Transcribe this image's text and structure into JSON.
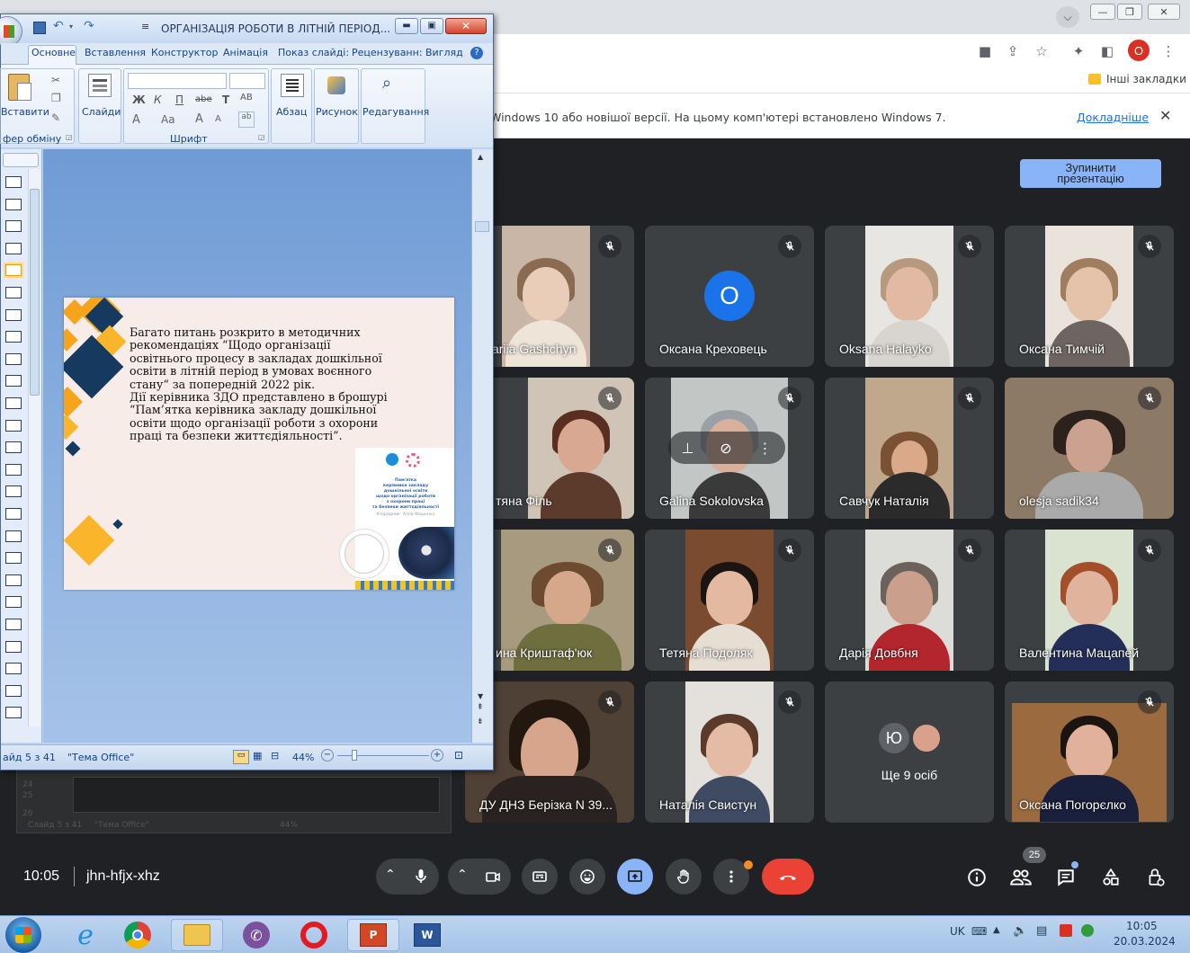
{
  "chrome": {
    "bookmarks_other": "Інші закладки",
    "profile_initial": "O",
    "infobar_text": "Windows 10 або новішої версії. На цьому комп'ютері встановлено Windows 7.",
    "infobar_link": "Докладніше"
  },
  "meet": {
    "stop_presenting": "Зупинити презентацію",
    "time": "10:05",
    "meeting_code": "jhn-hfjx-xhz",
    "participants_count": "25",
    "more_people": "Ще 9 осіб",
    "more_people_initial": "Ю",
    "tiles": [
      {
        "name": "ariia Gashchyn"
      },
      {
        "name": "Оксана Креховець",
        "initial": "О"
      },
      {
        "name": "Oksana Halayko"
      },
      {
        "name": "Оксана Тимчій"
      },
      {
        "name": "тяна Філь"
      },
      {
        "name": "Galina Sokolovska"
      },
      {
        "name": "Савчук Наталія"
      },
      {
        "name": "olesja sadik34"
      },
      {
        "name": "ина Криштаф'юк"
      },
      {
        "name": "Тетяна Подоляк"
      },
      {
        "name": "Дарія Довбня"
      },
      {
        "name": "Валентина Мацапей"
      },
      {
        "name": "ДУ ДНЗ Берізка N 39..."
      },
      {
        "name": "Наталія Свистун"
      },
      {
        "name": "Оксана Погорєлко"
      }
    ],
    "colors": {
      "accent": "#8ab4f8",
      "end_call": "#ea4335",
      "bg": "#202124",
      "tile": "#3c4043"
    }
  },
  "ppt": {
    "title": "ОРГАНІЗАЦІЯ РОБОТИ В ЛІТНІЙ ПЕРІОД...",
    "tabs": [
      "Основне",
      "Вставлення",
      "Конструктор",
      "Анімація",
      "Показ слайді:",
      "Рецензуванн:",
      "Вигляд"
    ],
    "groups": {
      "paste": "Вставити",
      "clipboard": "фер обміну",
      "slides": "Слайди",
      "font": "Шрифт",
      "paragraph": "Абзац",
      "drawing": "Рисунок",
      "editing": "Редагування"
    },
    "font_buttons": [
      "Ж",
      "К",
      "П",
      "abe",
      "Т",
      "AB",
      "A",
      "Aa",
      "A",
      "A"
    ],
    "slide_text": [
      "Багато питань розкрито в методичних",
      "рекомендаціях “Щодо організації",
      "освітнього процесу в закладах дошкільної",
      "освіти в літній період в умовах воєнного",
      "стану“ за попередній 2022 рік.",
      "Дії керівника ЗДО представлено в брошурі",
      "“Пам’ятка керівника закладу дошкільної",
      "освіти щодо організації роботи з охорони",
      "праці та безпеки життєдіяльності”."
    ],
    "brochure_text": [
      "Пам'ятка",
      "керівника закладу",
      "дошкільної освіти",
      "щодо організації роботи",
      "з охорони праці",
      "та безпеки життєдіяльності",
      "Упорядник: Алла Фещенко"
    ],
    "status_slide": "айд 5 з 41",
    "status_theme": "\"Тема Office\"",
    "zoom": "44%",
    "ghost_status": "Слайд 5 з 41",
    "ghost_theme": "\"Тема Office\"",
    "ghost_zoom": "44%",
    "ghost_row1": "24",
    "ghost_row2": "25",
    "ghost_row3": "26"
  },
  "taskbar": {
    "lang": "UK",
    "time": "10:05",
    "date": "20.03.2024"
  }
}
